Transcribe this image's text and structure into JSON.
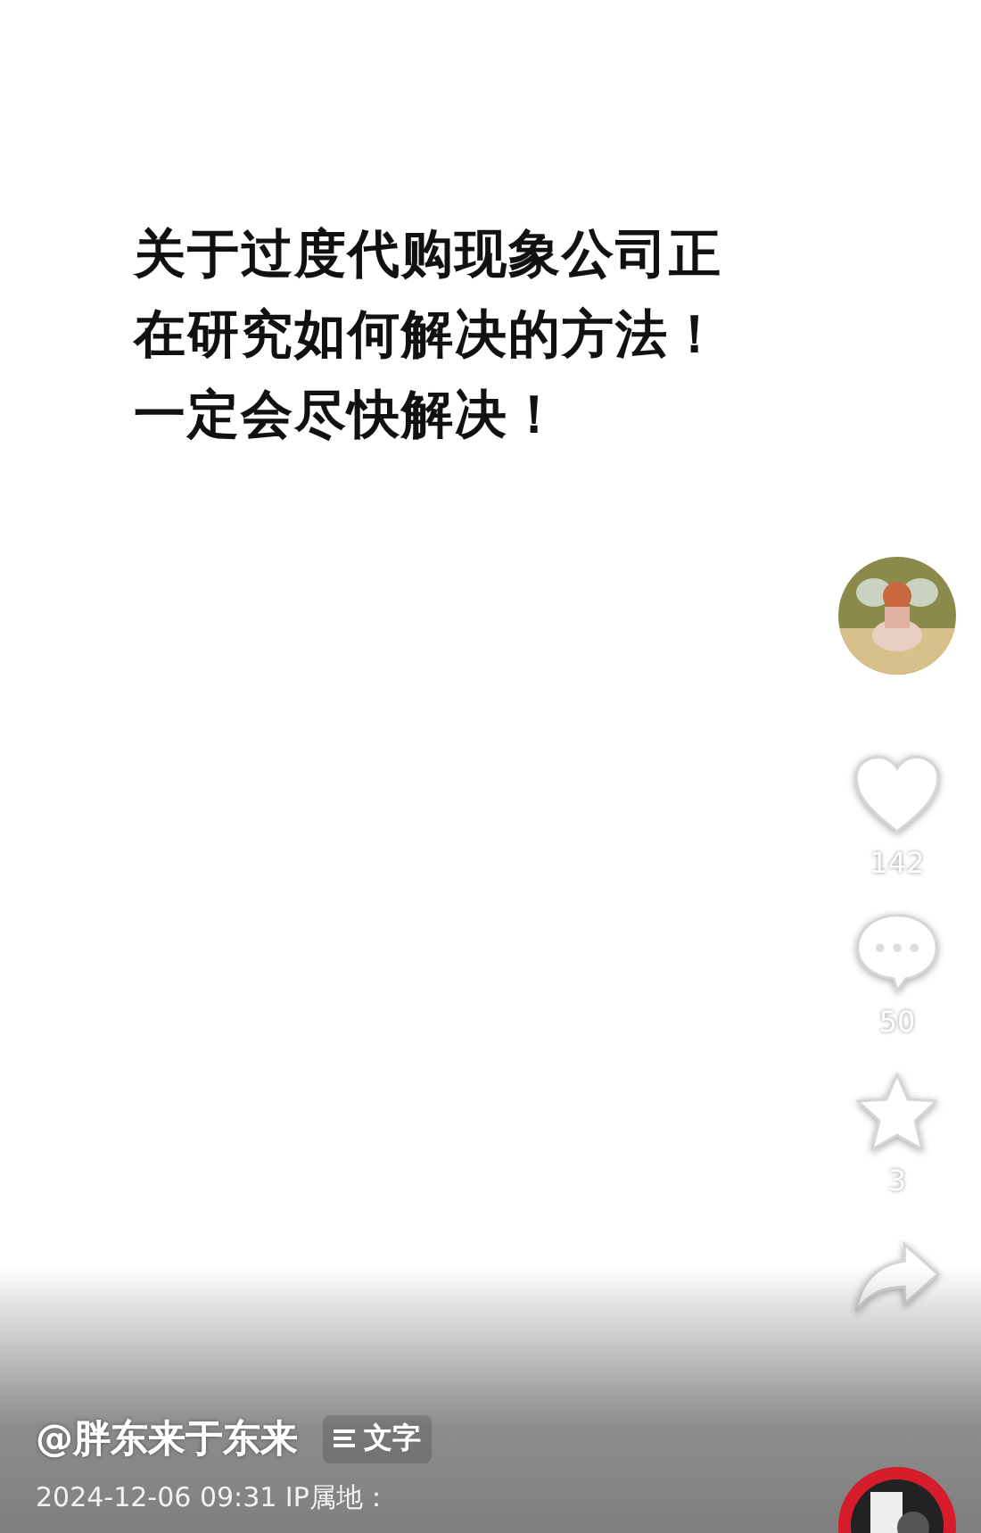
{
  "post_text": [
    "关于过度代购现象公司正",
    "在研究如何解决的方法！",
    "一定会尽快解决！"
  ],
  "actions": [
    {
      "kind": "like",
      "count": "142"
    },
    {
      "kind": "comment",
      "count": "50"
    },
    {
      "kind": "favorite",
      "count": "3"
    },
    {
      "kind": "share"
    }
  ],
  "author": "@胖东来于东来",
  "text_tag": "文字",
  "meta": "2024-12-06 09:31  IP属地："
}
